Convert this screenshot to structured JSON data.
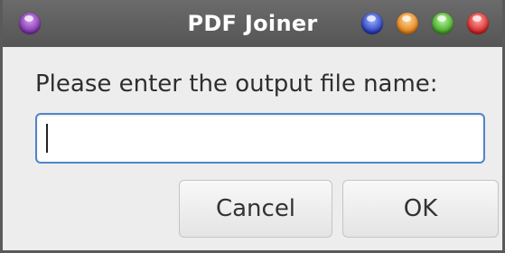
{
  "window": {
    "title": "PDF Joiner",
    "controls": {
      "menu_icon": "purple-orb-icon",
      "buttons": [
        "blue-orb-icon",
        "orange-orb-icon",
        "green-orb-icon",
        "red-orb-icon"
      ]
    }
  },
  "dialog": {
    "prompt": "Please enter the output file name:",
    "input": {
      "value": "",
      "placeholder": ""
    },
    "buttons": {
      "cancel_label": "Cancel",
      "ok_label": "OK"
    }
  },
  "colors": {
    "titlebar": "#555555",
    "input_focus_border": "#4f86c9",
    "dialog_background": "#ededed"
  }
}
